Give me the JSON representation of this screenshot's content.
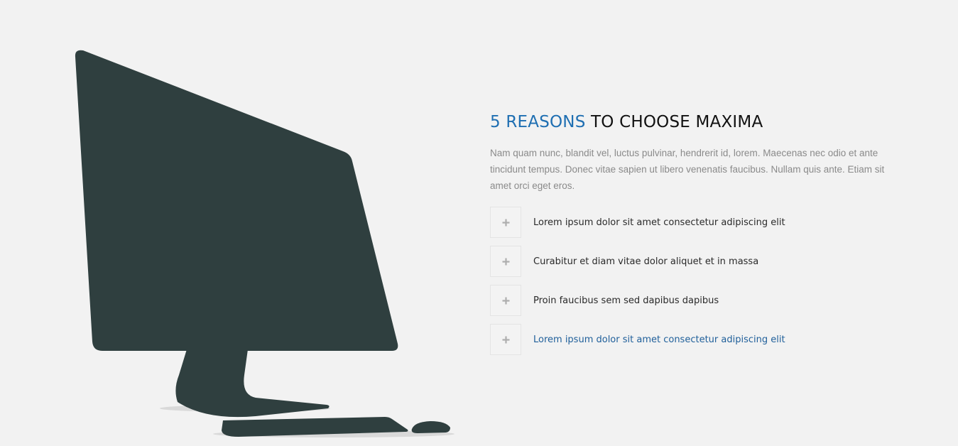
{
  "section": {
    "title_accent": "5 REASONS",
    "title_rest": "TO CHOOSE MAXIMA",
    "intro": "Nam quam nunc, blandit vel, luctus pulvinar, hendrerit id, lorem. Maecenas nec odio et ante tincidunt tempus. Donec vitae sapien ut libero venenatis faucibus. Nullam quis ante. Etiam sit amet orci eget eros.",
    "accent_color": "#1f6fb2"
  },
  "illustration": {
    "icon": "desktop-computer-icon",
    "color": "#2f3f3f"
  },
  "reasons": [
    {
      "label": "Lorem ipsum dolor sit amet consectetur adipiscing elit",
      "icon": "plus-icon",
      "active": false
    },
    {
      "label": "Curabitur et diam vitae dolor aliquet et in massa",
      "icon": "plus-icon",
      "active": false
    },
    {
      "label": "Proin faucibus sem sed dapibus dapibus",
      "icon": "plus-icon",
      "active": false
    },
    {
      "label": "Lorem ipsum dolor sit amet consectetur adipiscing elit",
      "icon": "plus-icon",
      "active": true
    }
  ]
}
